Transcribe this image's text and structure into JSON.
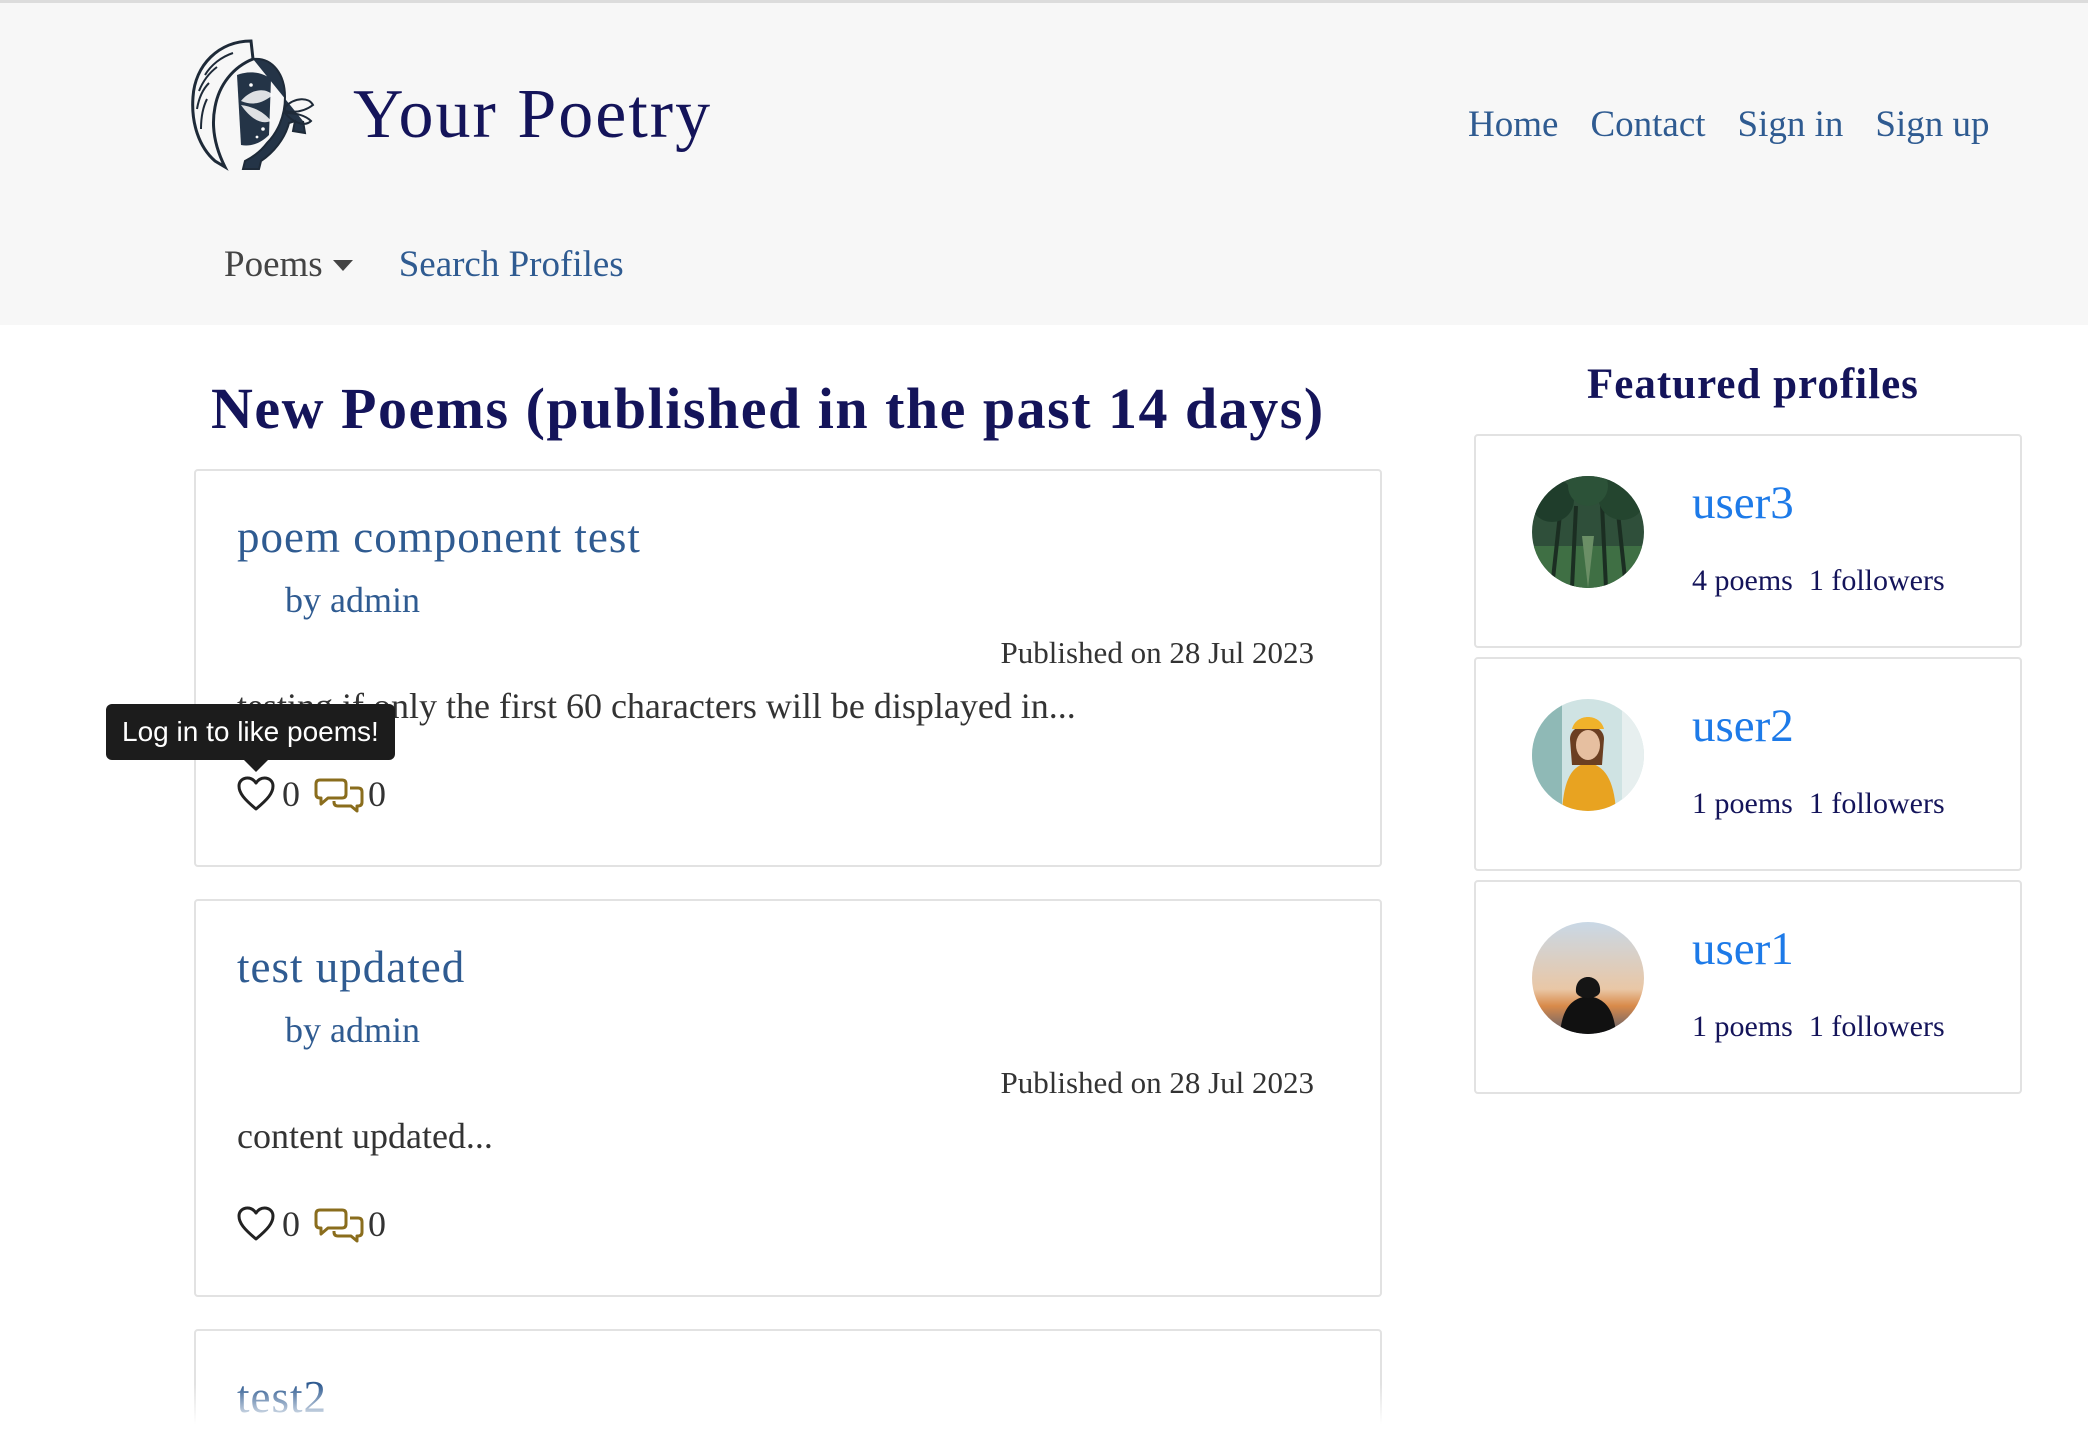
{
  "brand": {
    "title": "Your Poetry",
    "logo_icon": "woman-butterfly-logo-icon"
  },
  "topnav": [
    "Home",
    "Contact",
    "Sign in",
    "Sign up"
  ],
  "subnav": {
    "poems_dropdown": "Poems",
    "search_profiles": "Search Profiles"
  },
  "main": {
    "title": "New Poems (published in the past 14 days)",
    "poems": [
      {
        "title": "poem component test",
        "author": "by admin",
        "published": "Published on 28 Jul 2023",
        "excerpt": "testing if only the first 60 characters will be displayed in...",
        "likes": "0",
        "comments": "0"
      },
      {
        "title": "test updated",
        "author": "by admin",
        "published": "Published on 28 Jul 2023",
        "excerpt": "content updated...",
        "likes": "0",
        "comments": "0"
      },
      {
        "title": "test2"
      }
    ],
    "tooltip": "Log in to like poems!"
  },
  "sidebar": {
    "title": "Featured profiles",
    "profiles": [
      {
        "username": "user3",
        "poems": "4 poems",
        "followers": "1 followers"
      },
      {
        "username": "user2",
        "poems": "1 poems",
        "followers": "1 followers"
      },
      {
        "username": "user1",
        "poems": "1 poems",
        "followers": "1 followers"
      }
    ]
  },
  "colors": {
    "brand_navy": "#14145a",
    "link_blue": "#2f5b91",
    "profile_blue": "#1d7ae8",
    "comment_gold": "#8a6d1d",
    "header_bg": "#f7f7f7"
  }
}
